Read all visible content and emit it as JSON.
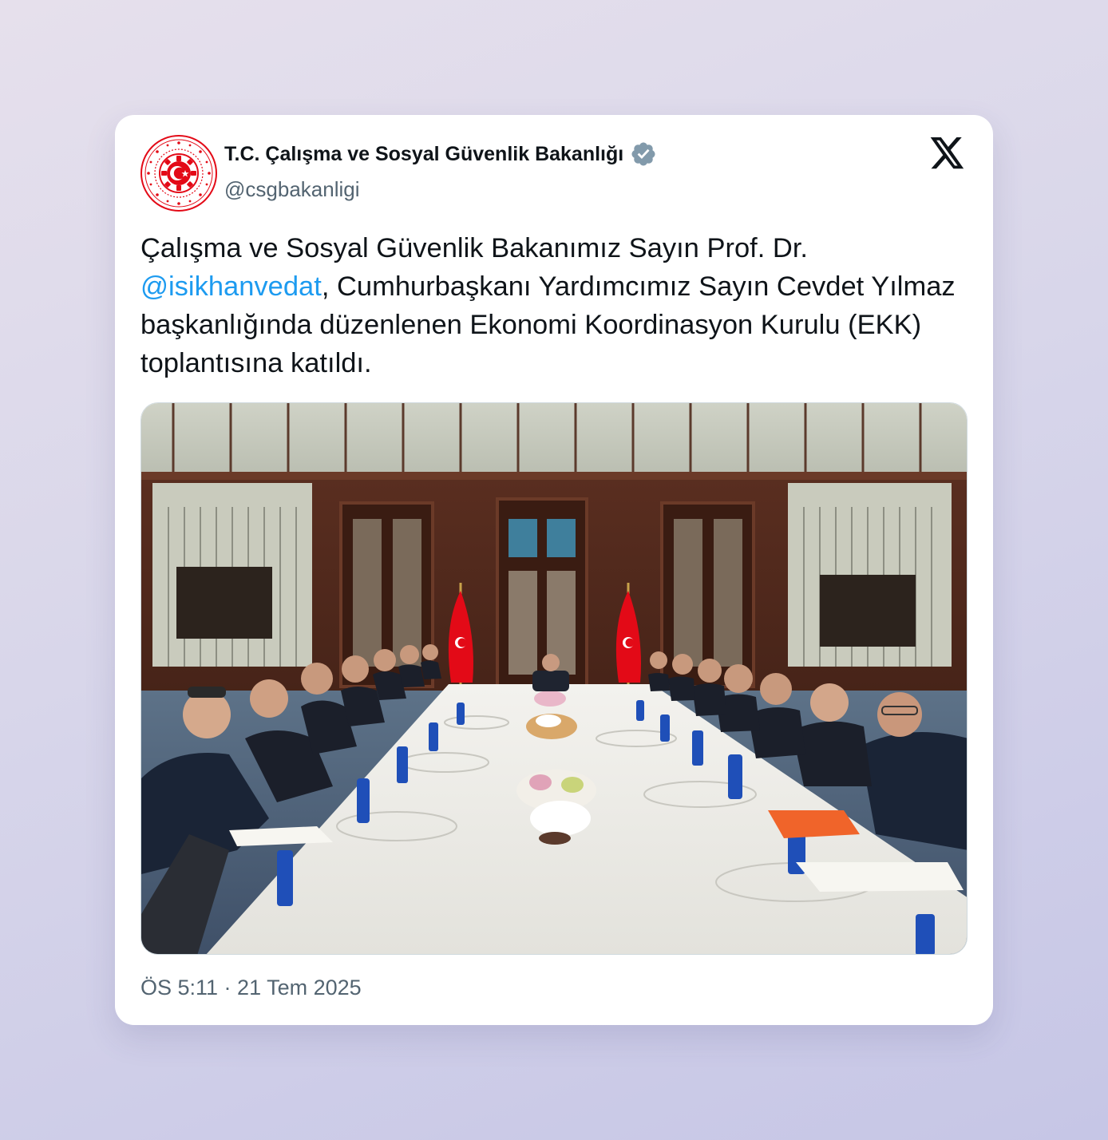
{
  "author": {
    "display_name": "T.C. Çalışma ve Sosyal Güvenlik Bakanlığı",
    "handle": "@csgbakanligi",
    "verified": true,
    "avatar_icon": "ministry-seal-icon",
    "avatar_seal_text": "T.C. ÇALIŞMA VE SOSYAL GÜVENLİK BAKANLIĞI"
  },
  "platform": {
    "logo_icon": "x-logo-icon"
  },
  "tweet": {
    "text_before_mention": "Çalışma ve Sosyal Güvenlik Bakanımız Sayın Prof. Dr. ",
    "mention": "@isikhanvedat",
    "text_after_mention": ", Cumhurbaşkanı Yardımcımız Sayın Cevdet Yılmaz başkanlığında düzenlenen Ekonomi Koordinasyon Kurulu (EKK) toplantısına katıldı."
  },
  "media": {
    "type": "photo",
    "subject": "meeting-room-photo"
  },
  "meta": {
    "timestamp": "ÖS 5:11 · 21 Tem 2025"
  },
  "colors": {
    "mention": "#1d9bf0",
    "verified_badge": "#829aab",
    "seal_red": "#e30a17",
    "muted_text": "#536471"
  }
}
